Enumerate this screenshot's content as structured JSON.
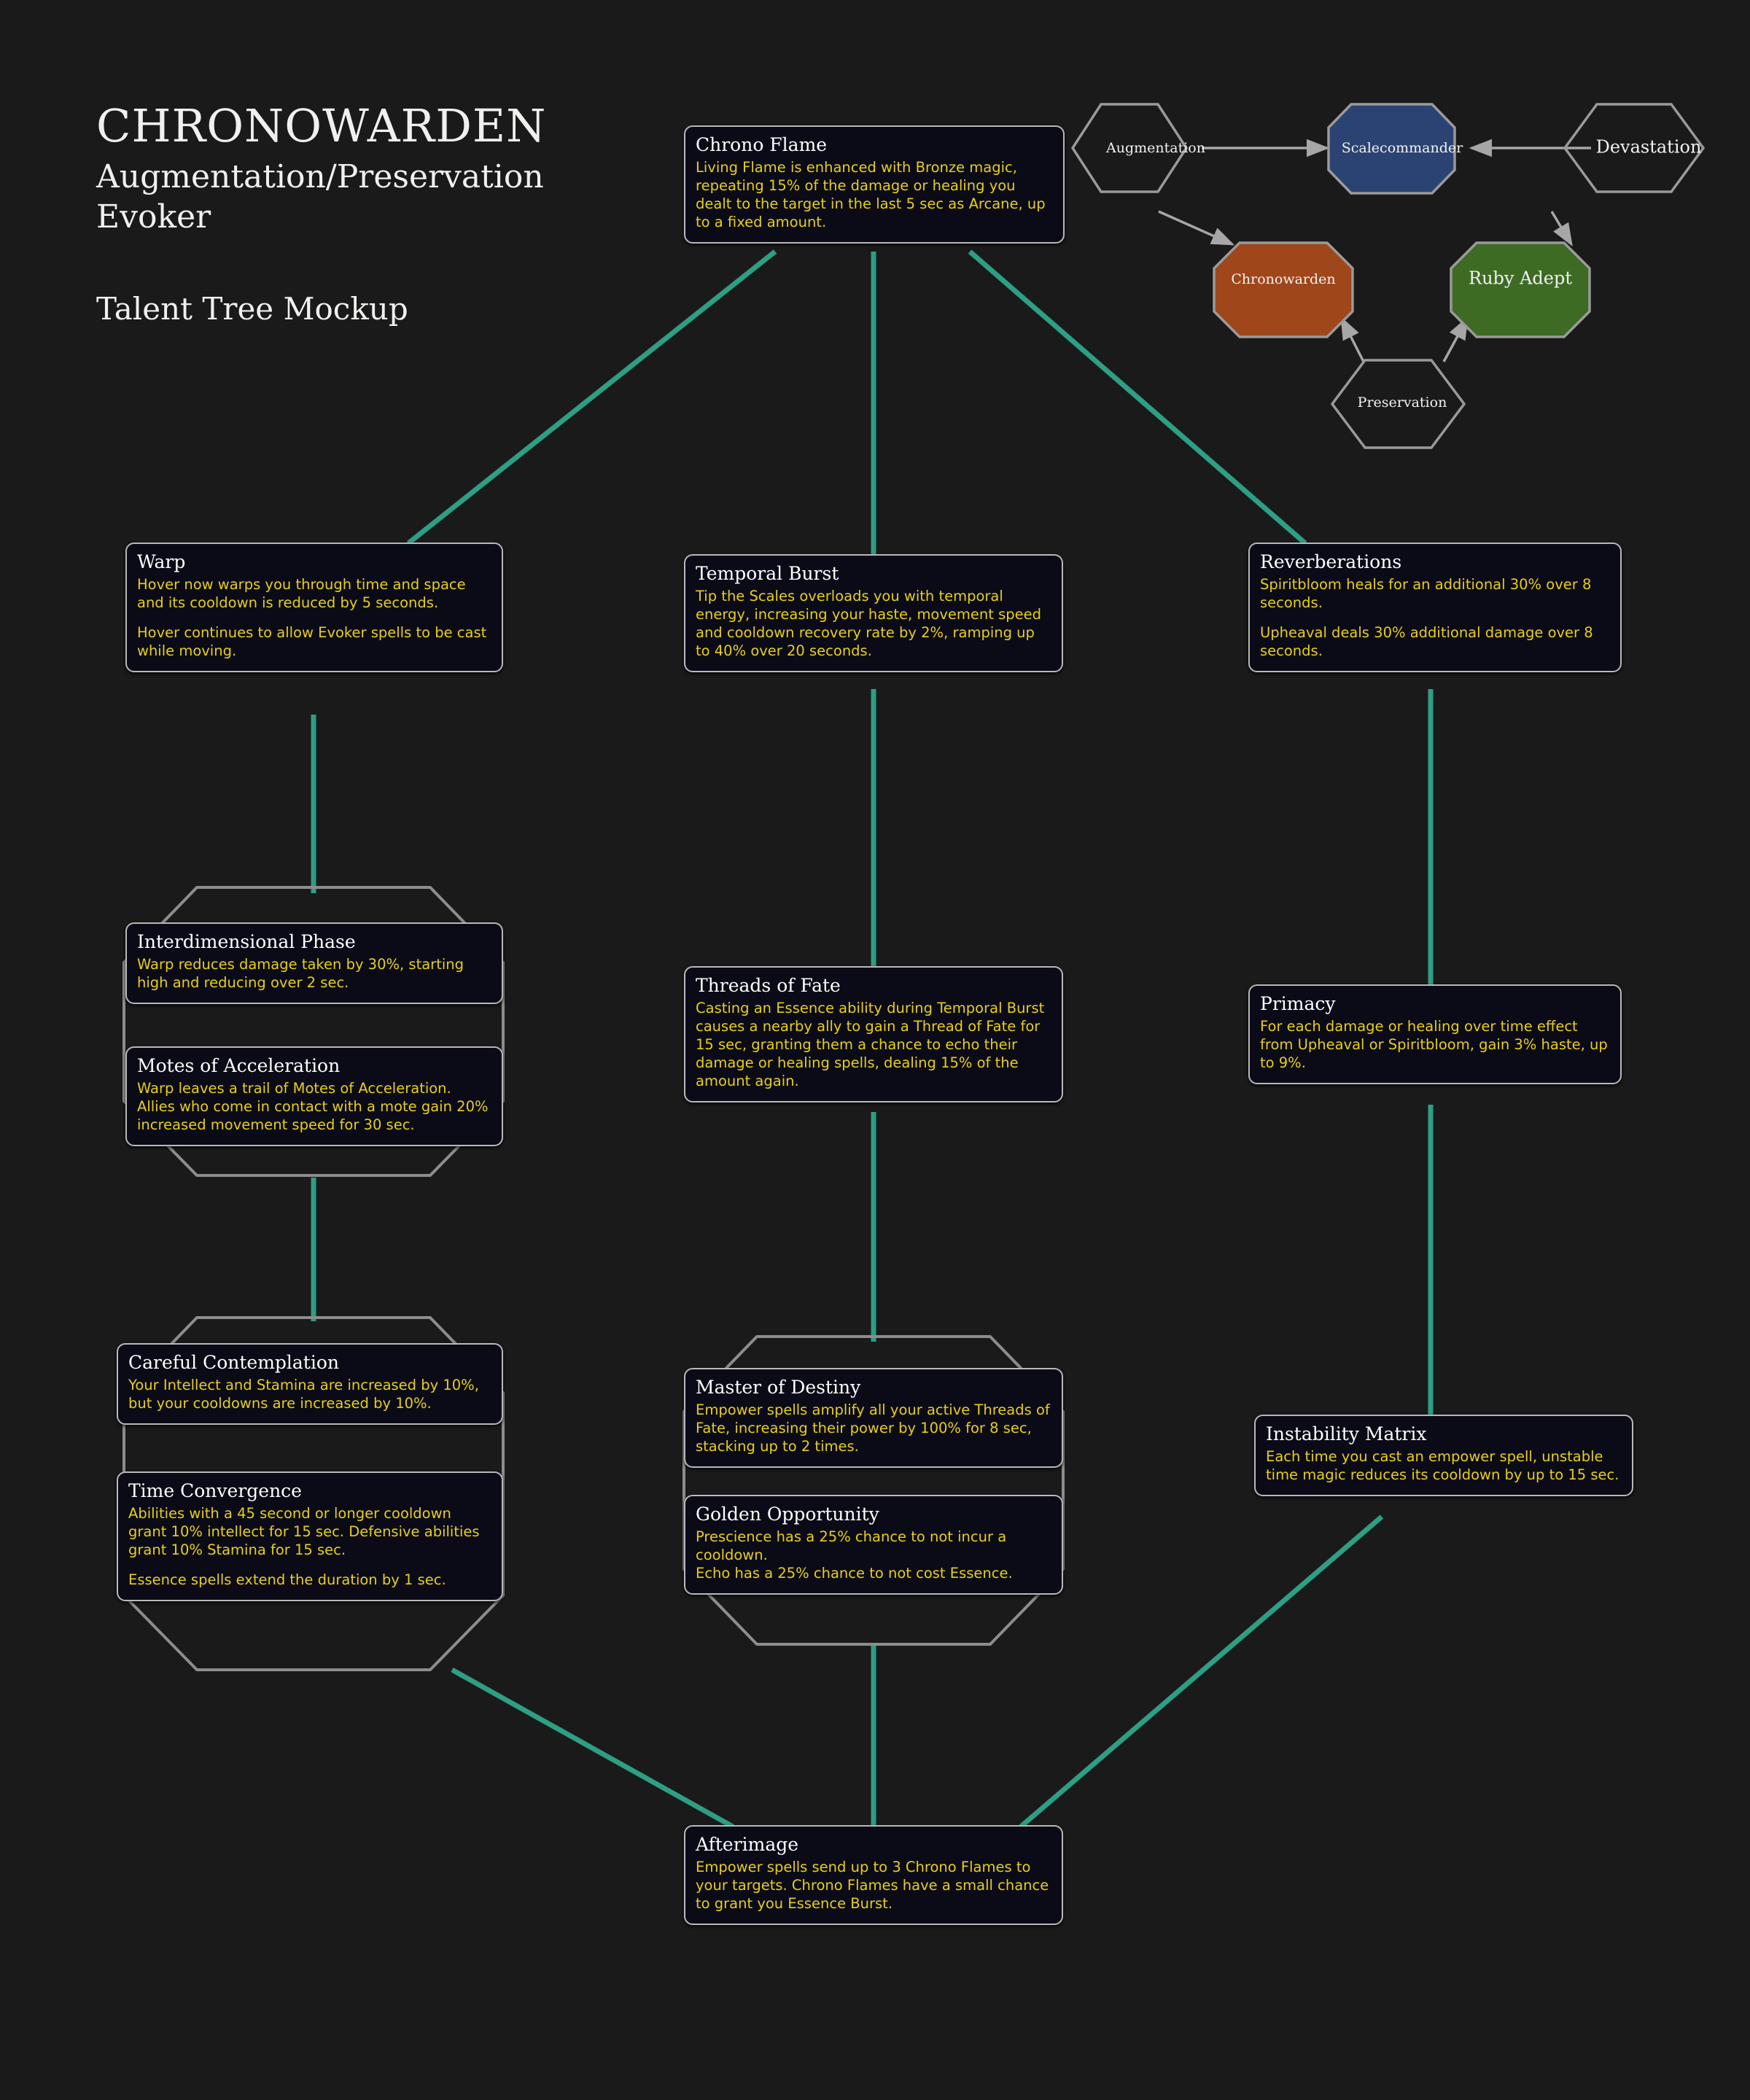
{
  "header": {
    "spec_name": "CHRONOWARDEN",
    "spec_subtitle_line1": "Augmentation/Preservation",
    "spec_subtitle_line2": "Evoker",
    "mockup_label": "Talent Tree Mockup"
  },
  "colors": {
    "background": "#1a1a1a",
    "node_fill": "#0b0b18",
    "node_border": "#b9b9b9",
    "title_text": "#ffffff",
    "body_text": "#e8cf17",
    "connector": "#2e9e84",
    "choice_outline": "#8d8d8d",
    "hex_outline": "#9a9a9a",
    "scalecommander_fill": "#2b4372",
    "chronowarden_fill": "#a0461b",
    "rubyadept_fill": "#3d6b24"
  },
  "spec_diagram": {
    "nodes": [
      {
        "id": "augmentation",
        "label": "Augmentation",
        "shape": "hexagon",
        "fill": "none",
        "size": "small"
      },
      {
        "id": "scalecommander",
        "label": "Scalecommander",
        "shape": "octagon",
        "fill": "#2b4372",
        "size": "small"
      },
      {
        "id": "devastation",
        "label": "Devastation",
        "shape": "hexagon",
        "fill": "none",
        "size": "big"
      },
      {
        "id": "chronowarden",
        "label": "Chronowarden",
        "shape": "octagon",
        "fill": "#a0461b",
        "size": "small"
      },
      {
        "id": "rubyadept",
        "label": "Ruby Adept",
        "shape": "octagon",
        "fill": "#3d6b24",
        "size": "big"
      },
      {
        "id": "preservation",
        "label": "Preservation",
        "shape": "hexagon",
        "fill": "none",
        "size": "small"
      }
    ],
    "arrows": [
      {
        "from": "augmentation",
        "to": "scalecommander"
      },
      {
        "from": "devastation",
        "to": "scalecommander"
      },
      {
        "from": "augmentation",
        "to": "chronowarden"
      },
      {
        "from": "devastation",
        "to": "rubyadept"
      },
      {
        "from": "preservation",
        "to": "chronowarden"
      },
      {
        "from": "preservation",
        "to": "rubyadept"
      }
    ]
  },
  "talents": {
    "chrono_flame": {
      "title": "Chrono Flame",
      "paragraphs": [
        "Living Flame is enhanced with Bronze magic, repeating 15% of the damage or healing you dealt to the target in the last 5 sec as Arcane, up to a fixed amount."
      ]
    },
    "warp": {
      "title": "Warp",
      "paragraphs": [
        "Hover now warps you through time and space and its cooldown is reduced by 5 seconds.",
        "Hover continues to allow Evoker spells to be cast while moving."
      ]
    },
    "temporal_burst": {
      "title": "Temporal Burst",
      "paragraphs": [
        "Tip the Scales overloads you with temporal energy, increasing your haste, movement speed and cooldown recovery rate by 2%, ramping up to 40% over 20 seconds."
      ]
    },
    "reverberations": {
      "title": "Reverberations",
      "paragraphs": [
        "Spiritbloom heals for an additional 30% over 8 seconds.",
        "Upheaval deals 30% additional damage over 8 seconds."
      ]
    },
    "interdimensional_phase": {
      "title": "Interdimensional Phase",
      "paragraphs": [
        "Warp reduces damage taken by 30%, starting high and reducing over 2 sec."
      ]
    },
    "motes_of_acceleration": {
      "title": "Motes of Acceleration",
      "paragraphs": [
        "Warp leaves a trail of Motes of Acceleration. Allies who come in contact with a mote gain 20% increased movement speed for 30 sec."
      ]
    },
    "threads_of_fate": {
      "title": "Threads of Fate",
      "paragraphs": [
        "Casting an Essence ability during Temporal Burst causes a nearby ally to gain a Thread of Fate for 15 sec, granting them a chance to echo their damage or healing spells, dealing 15% of the amount again."
      ]
    },
    "primacy": {
      "title": "Primacy",
      "paragraphs": [
        "For each damage or healing over time effect from Upheaval or Spiritbloom, gain 3% haste, up to 9%."
      ]
    },
    "careful_contemplation": {
      "title": "Careful Contemplation",
      "paragraphs": [
        "Your Intellect and Stamina are increased by 10%, but your cooldowns are increased by 10%."
      ]
    },
    "time_convergence": {
      "title": "Time Convergence",
      "paragraphs": [
        "Abilities with a 45 second or longer cooldown grant 10% intellect for 15 sec. Defensive abilities grant 10% Stamina for 15 sec.",
        "Essence spells extend the duration by 1 sec."
      ]
    },
    "master_of_destiny": {
      "title": "Master of Destiny",
      "paragraphs": [
        "Empower spells amplify all your active Threads of Fate, increasing their power by 100% for 8 sec, stacking up to 2 times."
      ]
    },
    "golden_opportunity": {
      "title": "Golden Opportunity",
      "paragraphs": [
        "Prescience has a 25% chance to not incur a cooldown.",
        "Echo has a 25% chance to not cost Essence."
      ]
    },
    "instability_matrix": {
      "title": "Instability Matrix",
      "paragraphs": [
        "Each time you cast an empower spell, unstable time magic reduces its cooldown by up to 15 sec."
      ]
    },
    "afterimage": {
      "title": "Afterimage",
      "paragraphs": [
        "Empower spells send up to 3 Chrono Flames to your targets. Chrono Flames have a small chance to grant you Essence Burst."
      ]
    }
  }
}
